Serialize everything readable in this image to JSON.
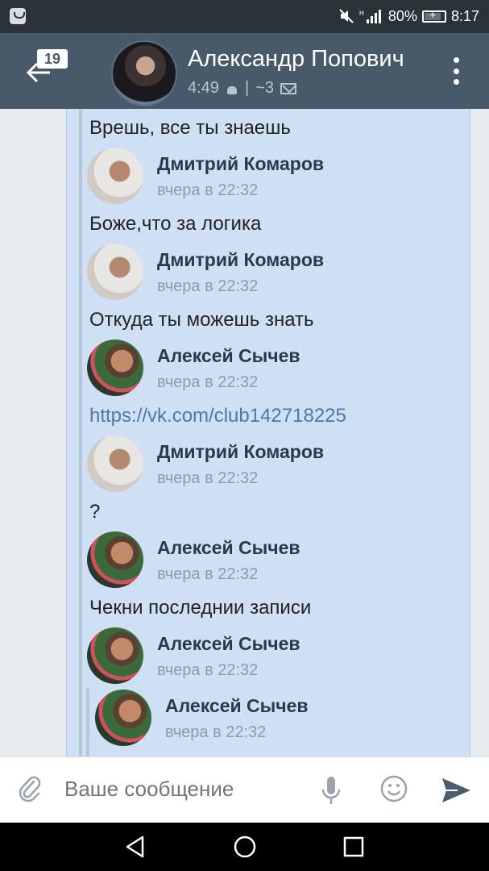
{
  "status_bar": {
    "battery": "80%",
    "time": "8:17"
  },
  "header": {
    "back_badge": "19",
    "contact_name": "Александр Попович",
    "last_seen": "4:49",
    "separator": "|",
    "message_count": "~3"
  },
  "forwarded": [
    {
      "type": "text",
      "text": "Врешь, все ты знаешь"
    },
    {
      "type": "author",
      "avatar": "dmitry",
      "name": "Дмитрий Комаров",
      "time": "вчера в 22:32"
    },
    {
      "type": "text",
      "text": "Боже,что за логика"
    },
    {
      "type": "author",
      "avatar": "dmitry",
      "name": "Дмитрий Комаров",
      "time": "вчера в 22:32"
    },
    {
      "type": "text",
      "text": "Откуда ты можешь знать"
    },
    {
      "type": "author",
      "avatar": "alexey",
      "name": "Алексей Сычев",
      "time": "вчера в 22:32"
    },
    {
      "type": "link",
      "text": "https://vk.com/club142718225"
    },
    {
      "type": "author",
      "avatar": "dmitry",
      "name": "Дмитрий Комаров",
      "time": "вчера в 22:32"
    },
    {
      "type": "text",
      "text": "?"
    },
    {
      "type": "author",
      "avatar": "alexey",
      "name": "Алексей Сычев",
      "time": "вчера в 22:32"
    },
    {
      "type": "text",
      "text": "Чекни последнии записи"
    },
    {
      "type": "author",
      "avatar": "alexey",
      "name": "Алексей Сычев",
      "time": "вчера в 22:32"
    },
    {
      "type": "author_nested",
      "avatar": "alexey",
      "name": "Алексей Сычев",
      "time": "вчера в 22:32"
    }
  ],
  "composer": {
    "placeholder": "Ваше сообщение"
  },
  "colors": {
    "header_bg": "#485a6a",
    "bubble_bg": "#cfe0f5",
    "link": "#4a7aa8"
  },
  "icons": [
    "notification-icon",
    "mute-icon",
    "signal-icon",
    "battery-icon",
    "back-arrow-icon",
    "android-icon",
    "mail-icon",
    "more-vert-icon",
    "paperclip-icon",
    "microphone-icon",
    "smile-icon",
    "send-icon",
    "nav-back-icon",
    "nav-home-icon",
    "nav-recent-icon"
  ]
}
